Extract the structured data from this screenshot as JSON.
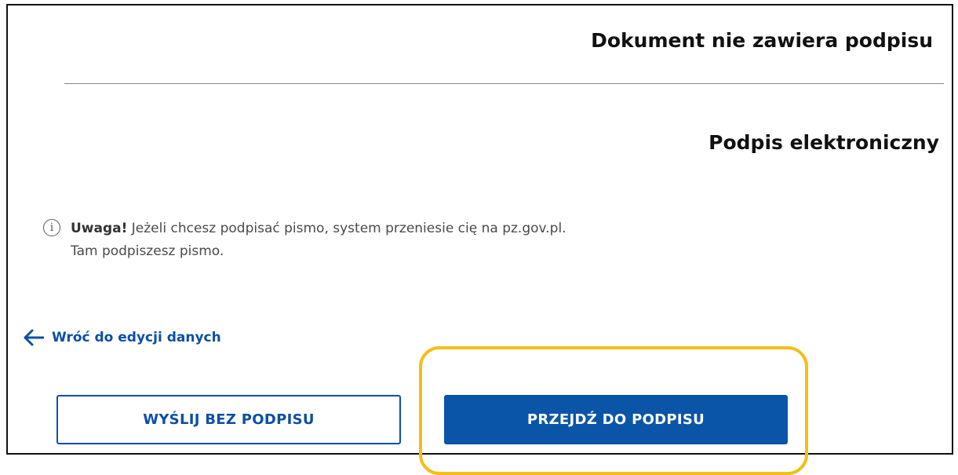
{
  "header": {
    "document_status": "Dokument nie zawiera podpisu"
  },
  "signature_section": {
    "title": "Podpis elektroniczny",
    "notice": {
      "icon": "info-icon",
      "icon_glyph": "i",
      "warning_label": "Uwaga!",
      "line1": "Jeżeli chcesz podpisać pismo, system przeniesie cię na pz.gov.pl.",
      "line2": "Tam podpiszesz pismo."
    }
  },
  "navigation": {
    "back_icon": "arrow-left-icon",
    "back_label": "Wróć do edycji danych"
  },
  "actions": {
    "send_without_signature": "WYŚLIJ BEZ PODPISU",
    "go_to_signature": "PRZEJDŹ DO PODPISU"
  },
  "colors": {
    "primary": "#0b55a8",
    "link": "#0b4fa6",
    "highlight": "#f5bd17"
  }
}
